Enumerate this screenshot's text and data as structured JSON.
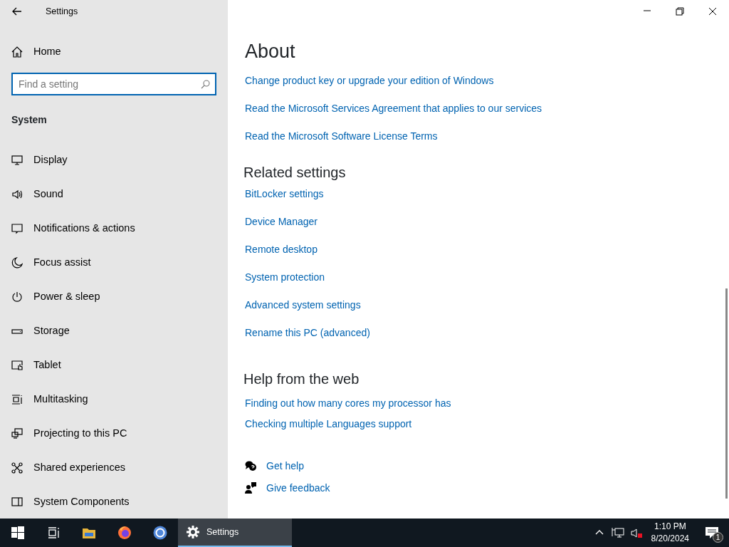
{
  "window": {
    "title": "Settings"
  },
  "sidebar": {
    "home": "Home",
    "search": {
      "placeholder": "Find a setting"
    },
    "section": "System",
    "items": [
      {
        "label": "Display"
      },
      {
        "label": "Sound"
      },
      {
        "label": "Notifications & actions"
      },
      {
        "label": "Focus assist"
      },
      {
        "label": "Power & sleep"
      },
      {
        "label": "Storage"
      },
      {
        "label": "Tablet"
      },
      {
        "label": "Multitasking"
      },
      {
        "label": "Projecting to this PC"
      },
      {
        "label": "Shared experiences"
      },
      {
        "label": "System Components"
      }
    ]
  },
  "main": {
    "title": "About",
    "links": [
      "Change product key or upgrade your edition of Windows",
      "Read the Microsoft Services Agreement that applies to our services",
      "Read the Microsoft Software License Terms"
    ],
    "related": {
      "heading": "Related settings",
      "links": [
        "BitLocker settings",
        "Device Manager",
        "Remote desktop",
        "System protection",
        "Advanced system settings",
        "Rename this PC (advanced)"
      ]
    },
    "help": {
      "heading": "Help from the web",
      "links": [
        "Finding out how many cores my processor has",
        "Checking multiple Languages support"
      ]
    },
    "actions": [
      {
        "kind": "help",
        "label": "Get help"
      },
      {
        "kind": "feedback",
        "label": "Give feedback"
      }
    ]
  },
  "taskbar": {
    "active_app": "Settings",
    "time": "1:10 PM",
    "date": "8/20/2024",
    "notification_count": "1"
  }
}
